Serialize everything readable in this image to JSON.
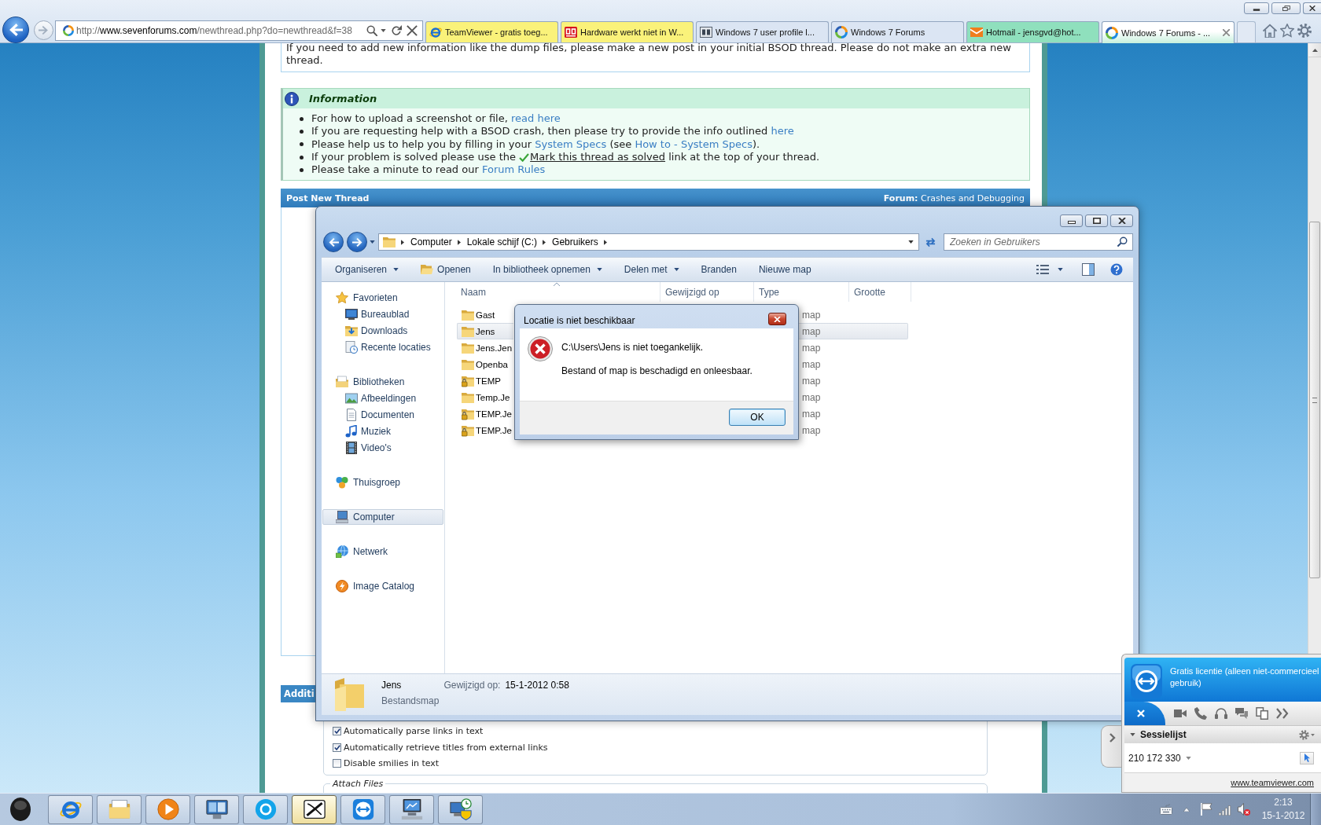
{
  "browser": {
    "address": {
      "scheme": "http://",
      "domain": "www.sevenforums.com",
      "path": "/newthread.php?do=newthread&f=38"
    },
    "tabs": [
      {
        "label": "TeamViewer - gratis toeg...",
        "color": "#faf27a",
        "selected": false
      },
      {
        "label": "Hardware werkt niet in W...",
        "color": "#faf27a",
        "selected": false
      },
      {
        "label": "Windows 7 user profile l...",
        "color": "#dbe5f3",
        "selected": false
      },
      {
        "label": "Windows 7 Forums",
        "color": "#dbe5f3",
        "selected": false
      },
      {
        "label": "Hotmail - jensgvd@hot...",
        "color": "#8fe0bd",
        "selected": false
      },
      {
        "label": "Windows 7 Forums - ...",
        "color": "#c6f0dc",
        "selected": true
      }
    ]
  },
  "forum": {
    "notice": "If you need to add new information like the dump files, please make a new post in your initial BSOD thread. Please do not make an extra new thread.",
    "info": {
      "title": "Information",
      "items": [
        {
          "segments": [
            {
              "kind": "text",
              "text": "For how to upload a screenshot or file, "
            },
            {
              "kind": "link",
              "text": "read here"
            }
          ]
        },
        {
          "segments": [
            {
              "kind": "text",
              "text": "If you are requesting help with a BSOD crash, then please try to provide the info outlined "
            },
            {
              "kind": "link",
              "text": "here"
            }
          ]
        },
        {
          "segments": [
            {
              "kind": "text",
              "text": "Please help us to help you by filling in your "
            },
            {
              "kind": "link",
              "text": "System Specs"
            },
            {
              "kind": "text",
              "text": " (see "
            },
            {
              "kind": "link",
              "text": "How to - System Specs"
            },
            {
              "kind": "text",
              "text": ")."
            }
          ]
        },
        {
          "segments": [
            {
              "kind": "text",
              "text": "If your problem is solved please use the "
            },
            {
              "kind": "action",
              "text": "Mark this thread as solved"
            },
            {
              "kind": "text",
              "text": " link at the top of your thread."
            }
          ]
        },
        {
          "segments": [
            {
              "kind": "text",
              "text": "Please take a minute to read our "
            },
            {
              "kind": "link",
              "text": "Forum Rules"
            }
          ]
        }
      ]
    },
    "post_bar": {
      "title": "Post New Thread",
      "forum": "**Forum:** Crashes and Debugging"
    },
    "section_bar": {
      "title": "Additi"
    },
    "options": [
      {
        "label": "Automatically parse links in text",
        "checked": true
      },
      {
        "label": "Automatically retrieve titles from external links",
        "checked": true
      },
      {
        "label": "Disable smilies in text",
        "checked": false
      }
    ],
    "attach_legend": "Attach Files"
  },
  "explorer": {
    "breadcrumb": [
      "Computer",
      "Lokale schijf (C:)",
      "Gebruikers"
    ],
    "search": {
      "placeholder": "Zoeken in Gebruikers"
    },
    "toolbar": [
      {
        "label": "Organiseren",
        "kind": "menu"
      },
      {
        "label": "Openen",
        "kind": "icon"
      },
      {
        "label": "In bibliotheek opnemen",
        "kind": "menu"
      },
      {
        "label": "Delen met",
        "kind": "menu"
      },
      {
        "label": "Branden",
        "kind": "plain"
      },
      {
        "label": "Nieuwe map",
        "kind": "plain"
      }
    ],
    "nav": [
      {
        "label": "Favorieten",
        "selected": false,
        "children": [
          {
            "label": "Bureaublad",
            "selected": false
          },
          {
            "label": "Downloads",
            "selected": false
          },
          {
            "label": "Recente locaties",
            "selected": false
          }
        ]
      },
      {
        "label": "Bibliotheken",
        "selected": false,
        "children": [
          {
            "label": "Afbeeldingen",
            "selected": false
          },
          {
            "label": "Documenten",
            "selected": false
          },
          {
            "label": "Muziek",
            "selected": false
          },
          {
            "label": "Video's",
            "selected": false
          }
        ]
      },
      {
        "label": "Thuisgroep",
        "selected": false
      },
      {
        "label": "Computer",
        "selected": true
      },
      {
        "label": "Netwerk",
        "selected": false
      },
      {
        "label": "Image Catalog",
        "selected": false
      }
    ],
    "columns": [
      "Naam",
      "Gewijzigd op",
      "Type",
      "Grootte"
    ],
    "rows": [
      {
        "name": "Gast",
        "type": "map",
        "locked": false,
        "selected": false
      },
      {
        "name": "Jens",
        "type": "map",
        "locked": false,
        "selected": true
      },
      {
        "name": "Jens.Jen",
        "type": "map",
        "locked": false,
        "selected": false
      },
      {
        "name": "Openba",
        "type": "map",
        "locked": false,
        "selected": false
      },
      {
        "name": "TEMP",
        "type": "map",
        "locked": true,
        "selected": false
      },
      {
        "name": "Temp.Je",
        "type": "map",
        "locked": false,
        "selected": false
      },
      {
        "name": "TEMP.Je",
        "type": "map",
        "locked": true,
        "selected": false
      },
      {
        "name": "TEMP.Je",
        "type": "map",
        "locked": true,
        "selected": false
      }
    ],
    "details": {
      "name": "Jens",
      "type": "Bestandsmap",
      "modified_label": "Gewijzigd op:",
      "modified": "15-1-2012 0:58"
    }
  },
  "dialog": {
    "title": "Locatie is niet beschikbaar",
    "lines": [
      "C:\\Users\\Jens is niet toegankelijk.",
      "Bestand of map is beschadigd en onleesbaar."
    ],
    "button": "OK"
  },
  "teamviewer": {
    "license": "Gratis licentie (alleen niet-commercieel gebruik)",
    "section": "Sessielijst",
    "partner_id": "210 172 330",
    "link": "www.teamviewer.com"
  },
  "taskbar": {
    "buttons": [
      {
        "selected": false
      },
      {
        "selected": false
      },
      {
        "selected": false
      },
      {
        "selected": false
      },
      {
        "selected": false
      },
      {
        "selected": true
      },
      {
        "selected": false
      },
      {
        "selected": false
      },
      {
        "selected": false
      }
    ],
    "time": "2:13",
    "date": "15-1-2012"
  }
}
